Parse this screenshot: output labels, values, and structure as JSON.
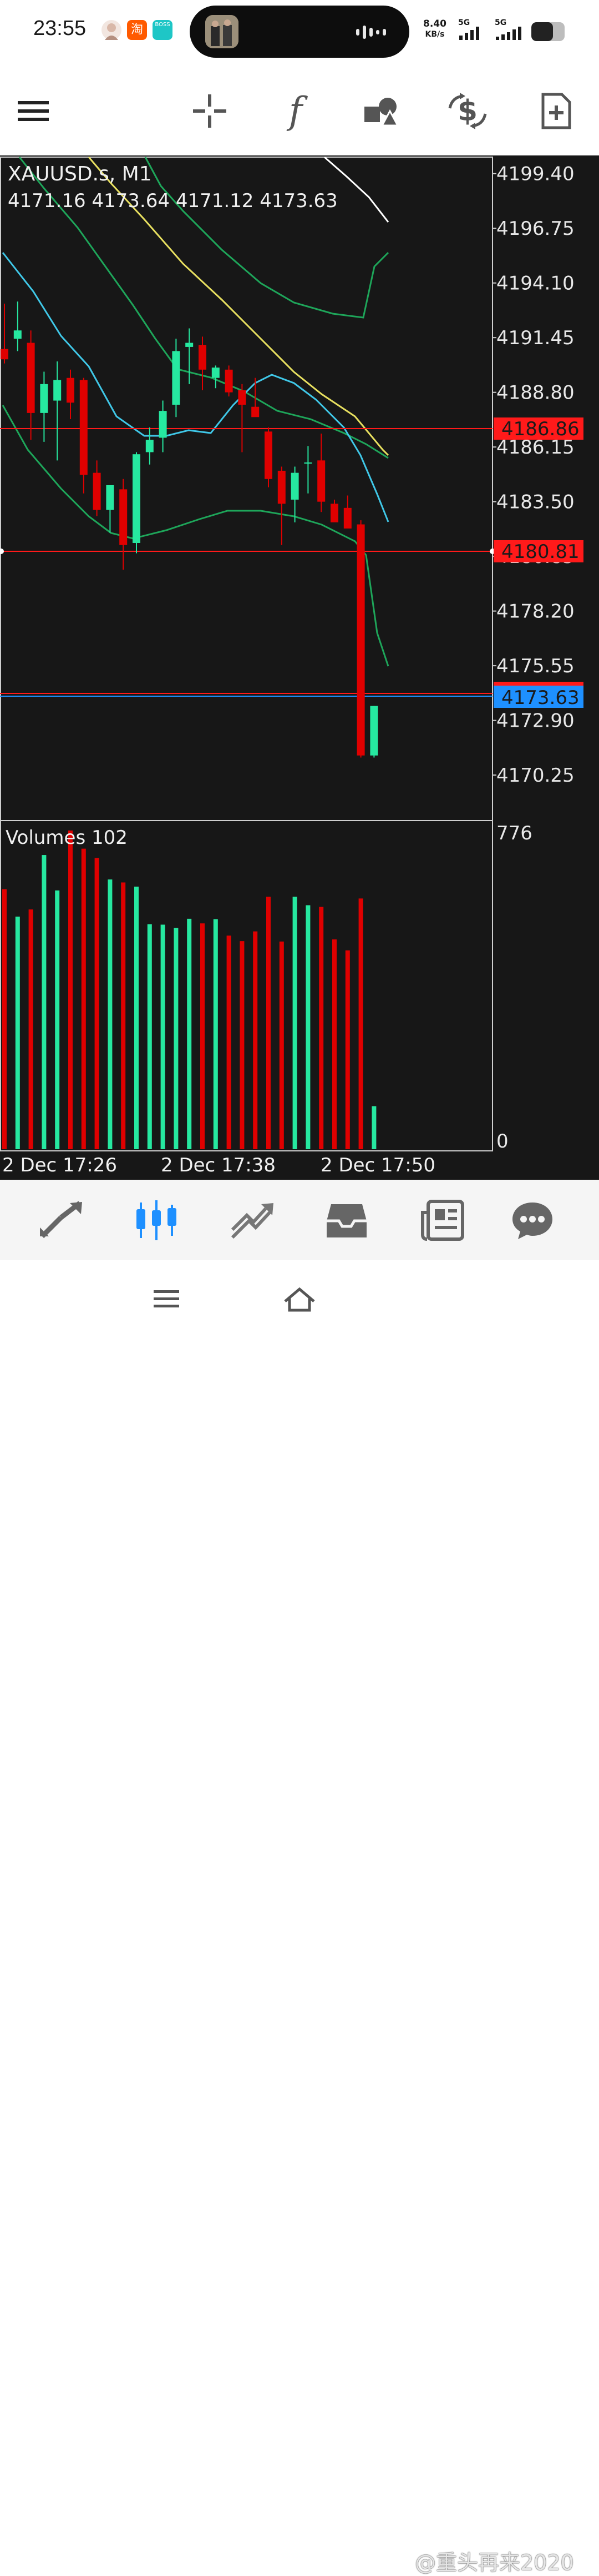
{
  "status_bar": {
    "time": "23:55",
    "net_speed_value": "8.40",
    "net_speed_unit": "KB/s",
    "sim1": "5G",
    "sim2": "5G",
    "app_icons": [
      "avatar-app-icon",
      "taobao-app-icon",
      "boss-app-icon"
    ],
    "taobao_glyph": "淘",
    "boss_text": "BOSS",
    "battery_percent": 65
  },
  "toolbar": {
    "icons": [
      "menu-icon",
      "crosshair-icon",
      "indicators-icon",
      "objects-icon",
      "trade-icon",
      "templates-icon"
    ],
    "indicators_glyph": "f"
  },
  "chart": {
    "symbol": "XAUUSD.s, M1",
    "ohlc": "4171.16 4173.64 4171.12 4173.63",
    "price_labels": [
      "4199.40",
      "4196.75",
      "4194.10",
      "4191.45",
      "4188.80",
      "4186.15",
      "4183.50",
      "4180.85",
      "4178.20",
      "4175.55",
      "4172.90",
      "4170.25"
    ],
    "level_top": {
      "price": "4186.86",
      "color": "#ff1a1a"
    },
    "level_mid": {
      "price": "4180.81",
      "color": "#ff1a1a"
    },
    "level_bid": {
      "price": "4173.63",
      "color": "#1e90ff"
    },
    "volumes_label": "Volumes 102",
    "volume_max_label": "776",
    "volume_min_label": "0",
    "time_labels": [
      "2 Dec 17:26",
      "2 Dec 17:38",
      "2 Dec 17:50"
    ],
    "colors": {
      "bull": "#26e8a0",
      "bear": "#e00000",
      "background": "#171717",
      "grid_text": "#e8e8e8",
      "ma_fast": "#40c8e8",
      "ma_slow": "#e8e060",
      "band": "#1ea65a",
      "ma_long": "#ffffff"
    }
  },
  "chart_data": {
    "type": "candlestick",
    "title": "XAUUSD.s, M1",
    "ylim": [
      4168.8,
      4200.2
    ],
    "candles": [
      {
        "o": 4190.9,
        "h": 4193.1,
        "l": 4190.2,
        "c": 4190.4
      },
      {
        "o": 4191.4,
        "h": 4193.2,
        "l": 4190.8,
        "c": 4191.8
      },
      {
        "o": 4191.2,
        "h": 4191.8,
        "l": 4186.5,
        "c": 4187.8
      },
      {
        "o": 4187.8,
        "h": 4189.8,
        "l": 4186.4,
        "c": 4189.2
      },
      {
        "o": 4188.4,
        "h": 4190.3,
        "l": 4185.5,
        "c": 4189.4
      },
      {
        "o": 4189.5,
        "h": 4189.9,
        "l": 4187.5,
        "c": 4188.3
      },
      {
        "o": 4189.4,
        "h": 4189.5,
        "l": 4183.9,
        "c": 4184.8
      },
      {
        "o": 4184.9,
        "h": 4185.5,
        "l": 4182.8,
        "c": 4183.1
      },
      {
        "o": 4183.1,
        "h": 4184.2,
        "l": 4182.0,
        "c": 4184.3
      },
      {
        "o": 4184.1,
        "h": 4184.6,
        "l": 4180.2,
        "c": 4181.4
      },
      {
        "o": 4181.5,
        "h": 4185.9,
        "l": 4181.0,
        "c": 4185.8
      },
      {
        "o": 4185.9,
        "h": 4187.1,
        "l": 4185.3,
        "c": 4186.5
      },
      {
        "o": 4186.6,
        "h": 4188.4,
        "l": 4185.9,
        "c": 4187.9
      },
      {
        "o": 4188.2,
        "h": 4191.4,
        "l": 4187.6,
        "c": 4190.8
      },
      {
        "o": 4191.0,
        "h": 4191.9,
        "l": 4189.2,
        "c": 4191.2
      },
      {
        "o": 4191.1,
        "h": 4191.5,
        "l": 4188.9,
        "c": 4189.9
      },
      {
        "o": 4189.5,
        "h": 4190.1,
        "l": 4189.0,
        "c": 4190.0
      },
      {
        "o": 4189.9,
        "h": 4190.1,
        "l": 4188.6,
        "c": 4188.8
      },
      {
        "o": 4188.9,
        "h": 4189.2,
        "l": 4185.9,
        "c": 4188.2
      },
      {
        "o": 4188.1,
        "h": 4189.5,
        "l": 4187.9,
        "c": 4187.6
      },
      {
        "o": 4186.9,
        "h": 4187.1,
        "l": 4184.2,
        "c": 4184.6
      },
      {
        "o": 4185.0,
        "h": 4185.2,
        "l": 4181.4,
        "c": 4183.4
      },
      {
        "o": 4183.6,
        "h": 4185.2,
        "l": 4182.5,
        "c": 4184.9
      },
      {
        "o": 4185.4,
        "h": 4186.2,
        "l": 4183.9,
        "c": 4185.4
      },
      {
        "o": 4185.5,
        "h": 4186.8,
        "l": 4183.0,
        "c": 4183.5
      },
      {
        "o": 4183.4,
        "h": 4183.6,
        "l": 4182.6,
        "c": 4182.5
      },
      {
        "o": 4183.2,
        "h": 4183.8,
        "l": 4182.5,
        "c": 4182.2
      },
      {
        "o": 4182.4,
        "h": 4182.6,
        "l": 4171.1,
        "c": 4171.2
      },
      {
        "o": 4171.2,
        "h": 4173.6,
        "l": 4171.1,
        "c": 4173.6
      }
    ],
    "volumes": {
      "max": 776,
      "values": [
        616,
        551,
        568,
        697,
        613,
        755,
        712,
        690,
        639,
        632,
        622,
        533,
        532,
        524,
        546,
        535,
        545,
        506,
        493,
        516,
        598,
        492,
        598,
        578,
        574,
        497,
        471,
        594,
        102
      ]
    },
    "price_levels": [
      4186.86,
      4180.81,
      4173.63
    ]
  },
  "bottom_nav": {
    "items": [
      "quotes-icon",
      "chart-icon",
      "trade-icon",
      "history-icon",
      "news-icon",
      "messages-icon"
    ],
    "active": 1
  },
  "system_nav": {
    "watermark": "@重头再来2020"
  }
}
